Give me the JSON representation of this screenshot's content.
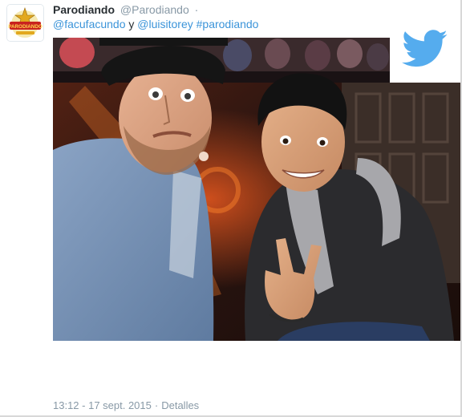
{
  "tweet": {
    "display_name": "Parodiando",
    "handle": "@Parodiando",
    "separator": "·",
    "mentions": [
      "@facufacundo",
      "@luisitorey"
    ],
    "conjunction": "y",
    "hashtag": "#parodiando",
    "timestamp": "13:12 - 17 sept. 2015",
    "details_label": "Detalles"
  },
  "avatar_logo_text": "PARODIANDO",
  "icons": {
    "platform_logo": "twitter-bird-icon"
  },
  "colors": {
    "link": "#3b94d9",
    "name": "#292f33",
    "muted": "#8899a6",
    "twitter_blue": "#55acee"
  }
}
